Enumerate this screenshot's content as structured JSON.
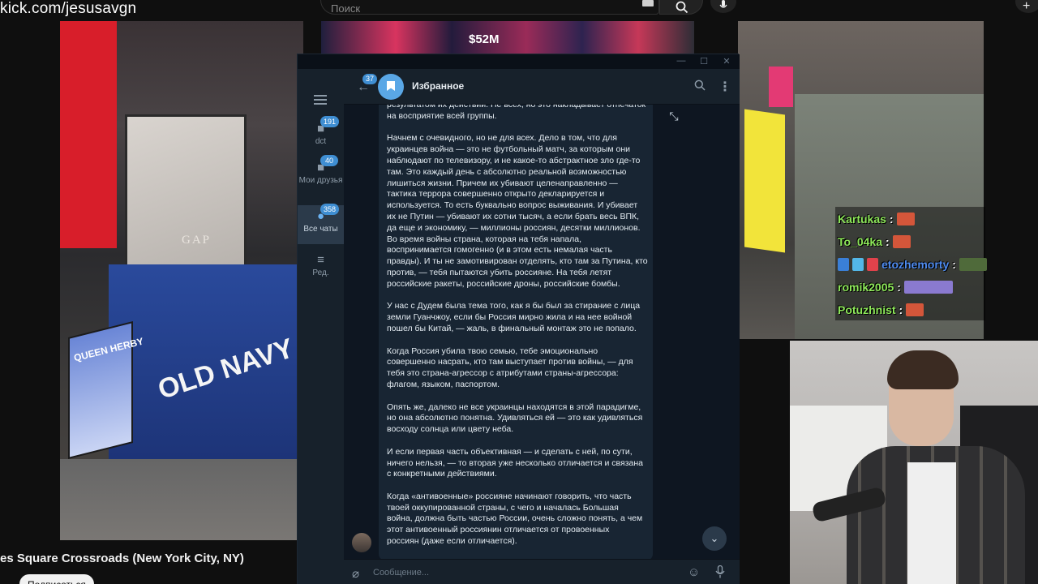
{
  "browser": {
    "url_overlay": "kick.com/jesusavgn",
    "search_placeholder": "Поиск"
  },
  "video": {
    "title": "es Square Crossroads (New York City, NY)",
    "subscribe_label": "Подписаться",
    "billboards": {
      "gap": "GAP",
      "old_navy": "OLD NAVY",
      "queen": "QUEEN HERBY",
      "money": "$52M"
    }
  },
  "stream_chat": [
    {
      "user": "Kartukas",
      "sep": ":"
    },
    {
      "user": "To_04ka",
      "sep": ":"
    },
    {
      "user": "etozhemorty",
      "sep": ":"
    },
    {
      "user": "romik2005",
      "sep": ":"
    },
    {
      "user": "Potuzhnist",
      "sep": ":"
    }
  ],
  "telegram": {
    "window_controls": [
      "—",
      "☐",
      "✕"
    ],
    "folders": [
      {
        "label": "dct",
        "badge": "191",
        "icon": "chat-bubble-icon"
      },
      {
        "label": "Мои друзья",
        "badge": "40",
        "icon": "chat-bubble-icon"
      },
      {
        "label": "Все чаты",
        "badge": "358",
        "icon": "chats-icon",
        "active": true
      },
      {
        "label": "Ред.",
        "badge": "",
        "icon": "sliders-icon"
      }
    ],
    "header": {
      "back_badge": "37",
      "chat_title": "Избранное"
    },
    "message": {
      "paragraphs": [
        "результатом их действий. Не всех, но это накладывает отпечаток\nна восприятие всей группы.",
        "Начнем с очевидного, но не для всех. Дело в том, что для\nукраинцев война — это не футбольный матч, за которым они\nнаблюдают по телевизору, и не какое-то абстрактное зло где-то\nтам. Это каждый день с абсолютно реальной возможностью\nлишиться жизни. Причем их убивают целенаправленно —\nтактика террора совершенно открыто декларируется и\nиспользуется. То есть буквально вопрос выживания. И убивает\nих не Путин — убивают их сотни тысяч, а если брать весь ВПК,\nда еще и экономику, — миллионы россиян, десятки миллионов.\nВо время войны страна, которая на тебя напала,\nвоспринимается гомогенно (и в этом есть немалая часть\nправды). И ты не замотивирован отделять, кто там за Путина, кто\nпротив, — тебя пытаются убить россияне. На тебя летят\nроссийские ракеты, российские дроны, российские бомбы.",
        "У нас с Дудем была тема того, как я бы был за стирание с лица\nземли Гуанчжоу, если бы Россия мирно жила и на нее войной\nпошел бы Китай, — жаль, в финальный монтаж это не попало.",
        "Когда Россия убила твою семью, тебе эмоционально\nсовершенно насрать, кто там выступает против войны, — для\nтебя это страна-агрессор с атрибутами страны-агрессора:\nфлагом, языком, паспортом.",
        "Опять же, далеко не все украинцы находятся в этой парадигме,\nно она абсолютно понятна. Удивляться ей — это как удивляться\nвосходу солнца или цвету неба.",
        "И если первая часть объективная — и сделать с ней, по сути,\nничего нельзя, — то вторая уже несколько отличается и связана\nс конкретными действиями.",
        "Когда «антивоенные» россияне начинают говорить, что часть\nтвоей оккупированной страны, с чего и началась Большая\nвойна, должна быть частью России, очень сложно понять, а чем\nэтот антивоенный россиянин отличается от провоенных\nроссиян (даже если отличается)."
      ]
    },
    "input": {
      "placeholder": "Сообщение..."
    },
    "colors": {
      "accent": "#5aa7e6",
      "badge": "#3f8ed2",
      "background": "#0e1621",
      "bubble": "#182533"
    }
  }
}
